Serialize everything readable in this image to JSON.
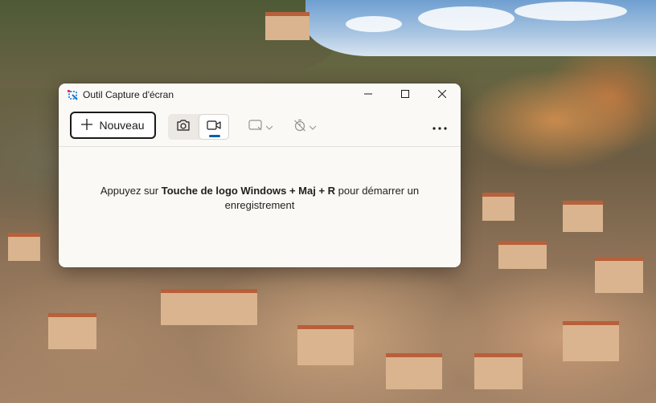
{
  "window": {
    "title": "Outil Capture d'écran"
  },
  "toolbar": {
    "new_label": "Nouveau",
    "modes": [
      {
        "icon": "camera-icon",
        "label": "",
        "active": false
      },
      {
        "icon": "video-camera-icon",
        "label": "",
        "active": true
      }
    ],
    "shape_icon": "rectangle-snip-icon",
    "delay_icon": "timer-off-icon",
    "more_icon": "more-options-icon"
  },
  "content": {
    "hint_before": "Appuyez sur ",
    "hint_bold": "Touche de logo Windows + Maj + R",
    "hint_after": " pour démarrer un enregistrement"
  },
  "colors": {
    "accent": "#0a5fa8",
    "window_bg": "#fbf9f6"
  }
}
